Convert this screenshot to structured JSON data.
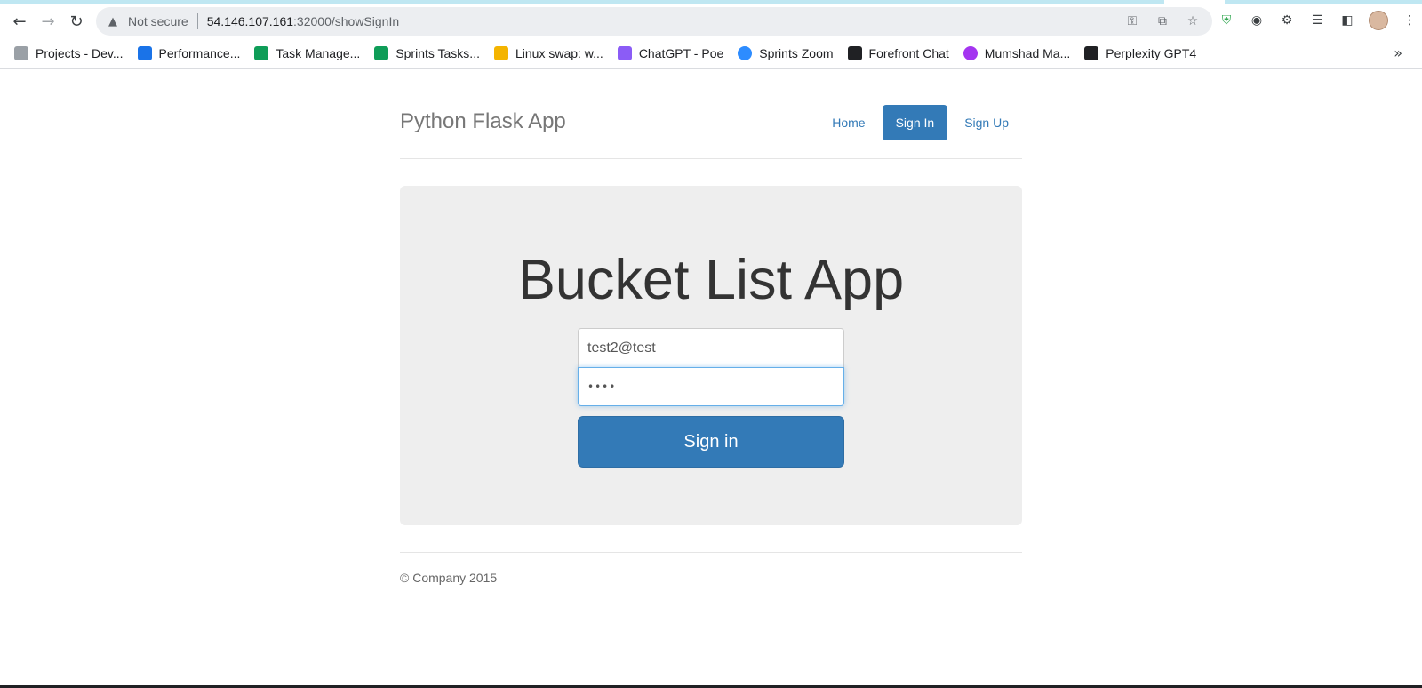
{
  "browser": {
    "security_label": "Not secure",
    "url_host": "54.146.107.161",
    "url_path": ":32000/showSignIn",
    "bookmarks": [
      {
        "label": "Projects - Dev...",
        "icon": "azure-devops-icon",
        "color": "#9aa0a6"
      },
      {
        "label": "Performance...",
        "icon": "shield-heart-icon",
        "color": "#1a73e8"
      },
      {
        "label": "Task Manage...",
        "icon": "sheets-icon",
        "color": "#0f9d58"
      },
      {
        "label": "Sprints Tasks...",
        "icon": "sheets-icon",
        "color": "#0f9d58"
      },
      {
        "label": "Linux swap: w...",
        "icon": "linux-icon",
        "color": "#f4b400"
      },
      {
        "label": "ChatGPT - Poe",
        "icon": "poe-icon",
        "color": "#8b5cf6"
      },
      {
        "label": "Sprints Zoom",
        "icon": "zoom-icon",
        "color": "#2d8cff"
      },
      {
        "label": "Forefront Chat",
        "icon": "forefront-icon",
        "color": "#202124"
      },
      {
        "label": "Mumshad Ma...",
        "icon": "udemy-icon",
        "color": "#a435f0"
      },
      {
        "label": "Perplexity GPT4",
        "icon": "grid-icon",
        "color": "#202124"
      }
    ],
    "more_bookmarks": "»"
  },
  "app": {
    "brand": "Python Flask App",
    "nav": [
      {
        "label": "Home",
        "active": false
      },
      {
        "label": "Sign In",
        "active": true
      },
      {
        "label": "Sign Up",
        "active": false
      }
    ],
    "heading": "Bucket List App",
    "email_value": "test2@test",
    "password_mask": "••••",
    "submit_label": "Sign in",
    "footer": "© Company 2015"
  },
  "colors": {
    "primary": "#337ab7",
    "jumbotron": "#eeeeee"
  }
}
